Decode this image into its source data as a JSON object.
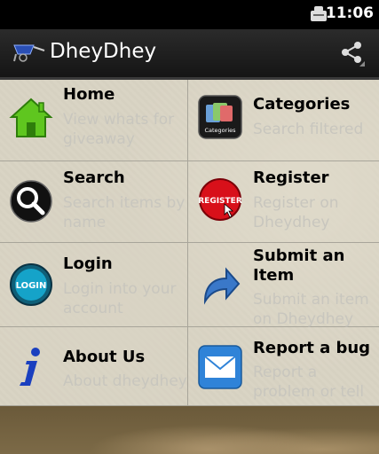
{
  "status_bar": {
    "time": "11:06"
  },
  "action_bar": {
    "title": "DheyDhey",
    "share_icon": "share-icon",
    "app_icon": "wheelbarrow-icon"
  },
  "menu": [
    {
      "title": "Home",
      "subtitle": "View whats for\ngiveaway",
      "icon": "home-icon"
    },
    {
      "title": "Categories",
      "subtitle": "Search filtered",
      "icon": "categories-icon",
      "icon_label": "Categories"
    },
    {
      "title": "Search",
      "subtitle": "Search items by\nname",
      "icon": "search-icon"
    },
    {
      "title": "Register",
      "subtitle": "Register on\nDheydhey",
      "icon": "register-icon",
      "icon_label": "REGISTER"
    },
    {
      "title": "Login",
      "subtitle": "Login into your\naccount",
      "icon": "login-icon",
      "icon_label": "LOGIN"
    },
    {
      "title": "Submit an\nItem",
      "subtitle": "Submit an item\non Dheydhey",
      "icon": "submit-arrow-icon"
    },
    {
      "title": "About Us",
      "subtitle": "About dheydhey",
      "icon": "info-icon"
    },
    {
      "title": "Report a bug",
      "subtitle": "Report a\nproblem or tell",
      "icon": "mail-icon"
    }
  ]
}
